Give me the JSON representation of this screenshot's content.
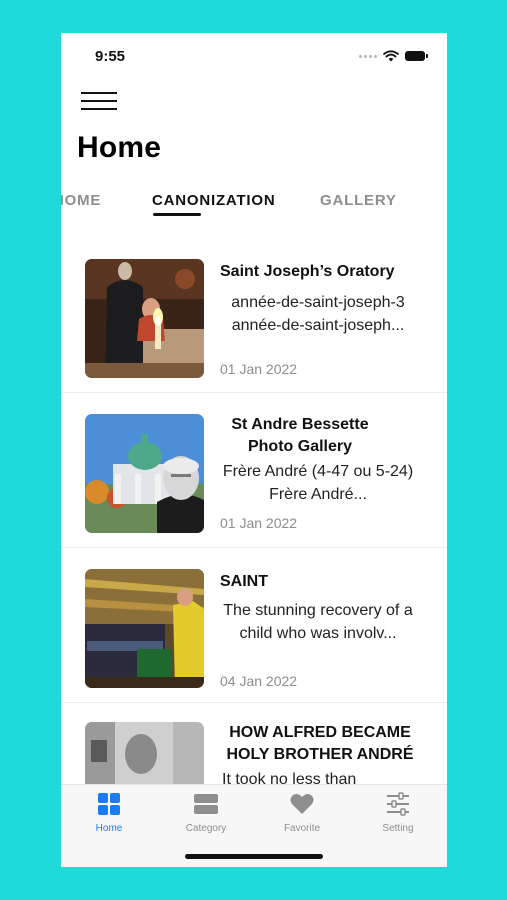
{
  "status_bar": {
    "time": "9:55"
  },
  "header": {
    "title": "Home"
  },
  "tabs": [
    {
      "label": "HOME"
    },
    {
      "label": "CANONIZATION"
    },
    {
      "label": "GALLERY"
    }
  ],
  "active_tab": "CANONIZATION",
  "articles": [
    {
      "title": "Saint Joseph’s Oratory",
      "description": "année-de-saint-joseph-3 année-de-saint-joseph...",
      "date": "01 Jan 2022"
    },
    {
      "title": "St Andre Bessette Photo Gallery",
      "description": "Frère André (4-47 ou 5-24) Frère André...",
      "date": "01 Jan 2022"
    },
    {
      "title": "SAINT",
      "description": "The stunning recovery of a child who was involv...",
      "date": "04 Jan 2022"
    },
    {
      "title": "HOW ALFRED BECAME HOLY BROTHER ANDRÉ",
      "description": "It took no less than",
      "date": ""
    }
  ],
  "bottom_nav": [
    {
      "label": "Home",
      "icon": "grid-icon",
      "active": true
    },
    {
      "label": "Category",
      "icon": "category-icon",
      "active": false
    },
    {
      "label": "Favorite",
      "icon": "heart-icon",
      "active": false
    },
    {
      "label": "Setting",
      "icon": "sliders-icon",
      "active": false
    }
  ],
  "colors": {
    "background": "#1fdada",
    "accent": "#1e7cf2",
    "inactive": "#8e8e8e"
  }
}
